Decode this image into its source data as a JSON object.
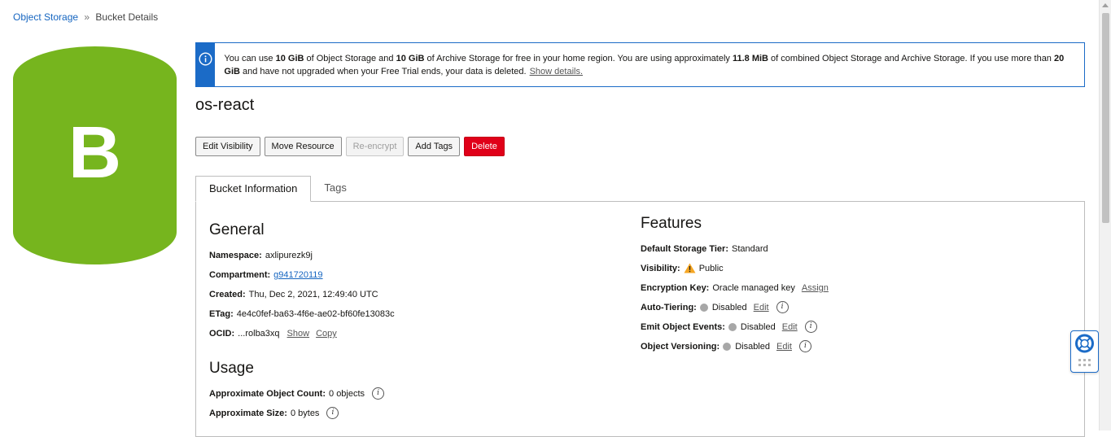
{
  "breadcrumb": {
    "root": "Object Storage",
    "separator": "»",
    "current": "Bucket Details"
  },
  "bucket_icon": {
    "letter": "B",
    "color": "#76b51e"
  },
  "banner": {
    "t1": "You can use ",
    "b1": "10 GiB",
    "t2": " of Object Storage and ",
    "b2": "10 GiB",
    "t3": " of Archive Storage for free in your home region. You are using approximately ",
    "b3": "11.8 MiB",
    "t4": " of combined Object Storage and Archive Storage. If you use more than ",
    "b4": "20 GiB",
    "t5": " and have not upgraded when your Free Trial ends, your data is deleted.",
    "link": "Show details."
  },
  "title": "os-react",
  "actions": {
    "edit_visibility": "Edit Visibility",
    "move_resource": "Move Resource",
    "reencrypt": "Re-encrypt",
    "add_tags": "Add Tags",
    "delete": "Delete"
  },
  "tabs": {
    "bucket_info": "Bucket Information",
    "tags": "Tags"
  },
  "general": {
    "title": "General",
    "namespace_label": "Namespace:",
    "namespace": "axlipurezk9j",
    "compartment_label": "Compartment:",
    "compartment": "g941720119",
    "created_label": "Created:",
    "created": "Thu, Dec 2, 2021, 12:49:40 UTC",
    "etag_label": "ETag:",
    "etag": "4e4c0fef-ba63-4f6e-ae02-bf60fe13083c",
    "ocid_label": "OCID:",
    "ocid": "...rolba3xq",
    "show": "Show",
    "copy": "Copy"
  },
  "usage": {
    "title": "Usage",
    "count_label": "Approximate Object Count:",
    "count": "0 objects",
    "size_label": "Approximate Size:",
    "size": "0 bytes"
  },
  "features": {
    "title": "Features",
    "tier_label": "Default Storage Tier:",
    "tier": "Standard",
    "visibility_label": "Visibility:",
    "visibility": "Public",
    "encryption_label": "Encryption Key:",
    "encryption": "Oracle managed key",
    "assign": "Assign",
    "autotier_label": "Auto-Tiering:",
    "autotier": "Disabled",
    "events_label": "Emit Object Events:",
    "events": "Disabled",
    "versioning_label": "Object Versioning:",
    "versioning": "Disabled",
    "edit": "Edit"
  },
  "colors": {
    "accent": "#1b6bc7",
    "danger": "#e00019",
    "bucket_green": "#76b51e",
    "warning": "#f5a623"
  },
  "icons": [
    "info-icon",
    "warning-icon",
    "help-icon",
    "lifebuoy-icon",
    "grip-icon"
  ]
}
